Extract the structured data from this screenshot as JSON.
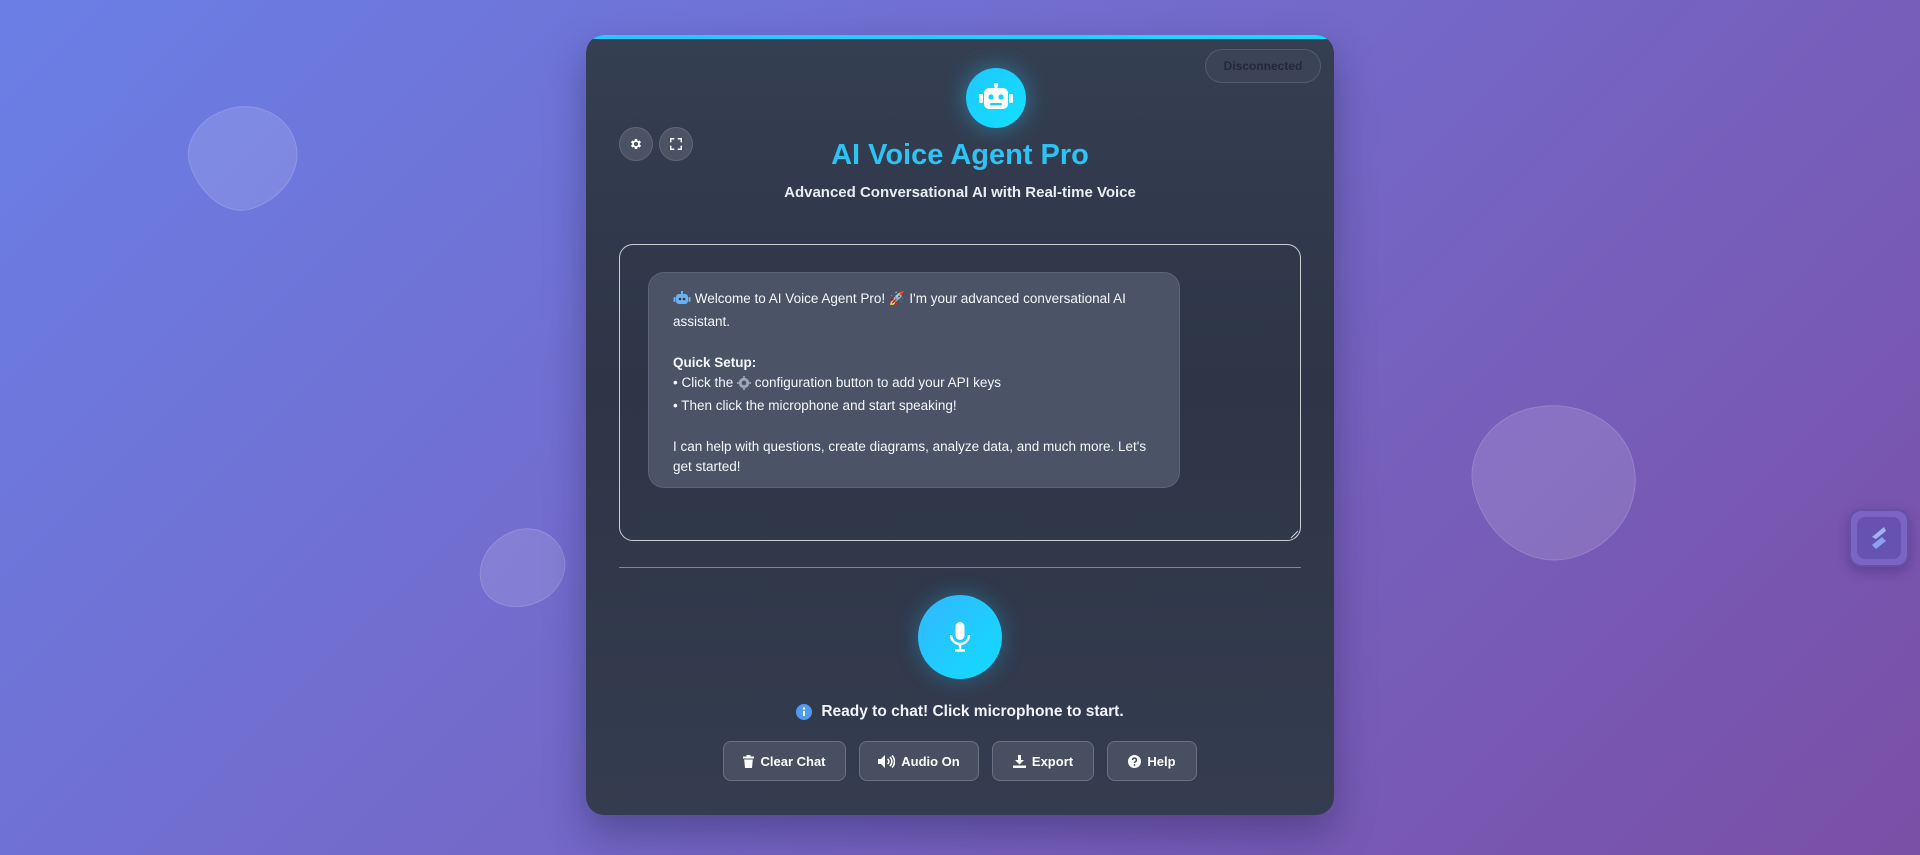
{
  "app": {
    "title": "AI Voice Agent Pro",
    "subtitle": "Advanced Conversational AI with Real-time Voice"
  },
  "connection": {
    "status": "Disconnected"
  },
  "toolbar": {
    "settings_icon": "gear-icon",
    "fullscreen_icon": "expand-icon"
  },
  "chat": {
    "messages": [
      {
        "role": "assistant",
        "intro": "Welcome to AI Voice Agent Pro! 🚀 I'm your advanced conversational AI assistant.",
        "setup_heading": "Quick Setup:",
        "setup_line_1_before": "• Click the",
        "setup_line_1_after": "configuration button to add your API keys",
        "setup_line_2": "• Then click the microphone and start speaking!",
        "outro": "I can help with questions, create diagrams, analyze data, and much more. Let's get started!"
      }
    ]
  },
  "status": {
    "message": "Ready to chat! Click microphone to start."
  },
  "actions": {
    "clear": "Clear Chat",
    "audio": "Audio On",
    "export": "Export",
    "help": "Help"
  },
  "colors": {
    "accent": "#2cc3f5",
    "card": "#2f3748",
    "bubble": "#4a5466"
  }
}
